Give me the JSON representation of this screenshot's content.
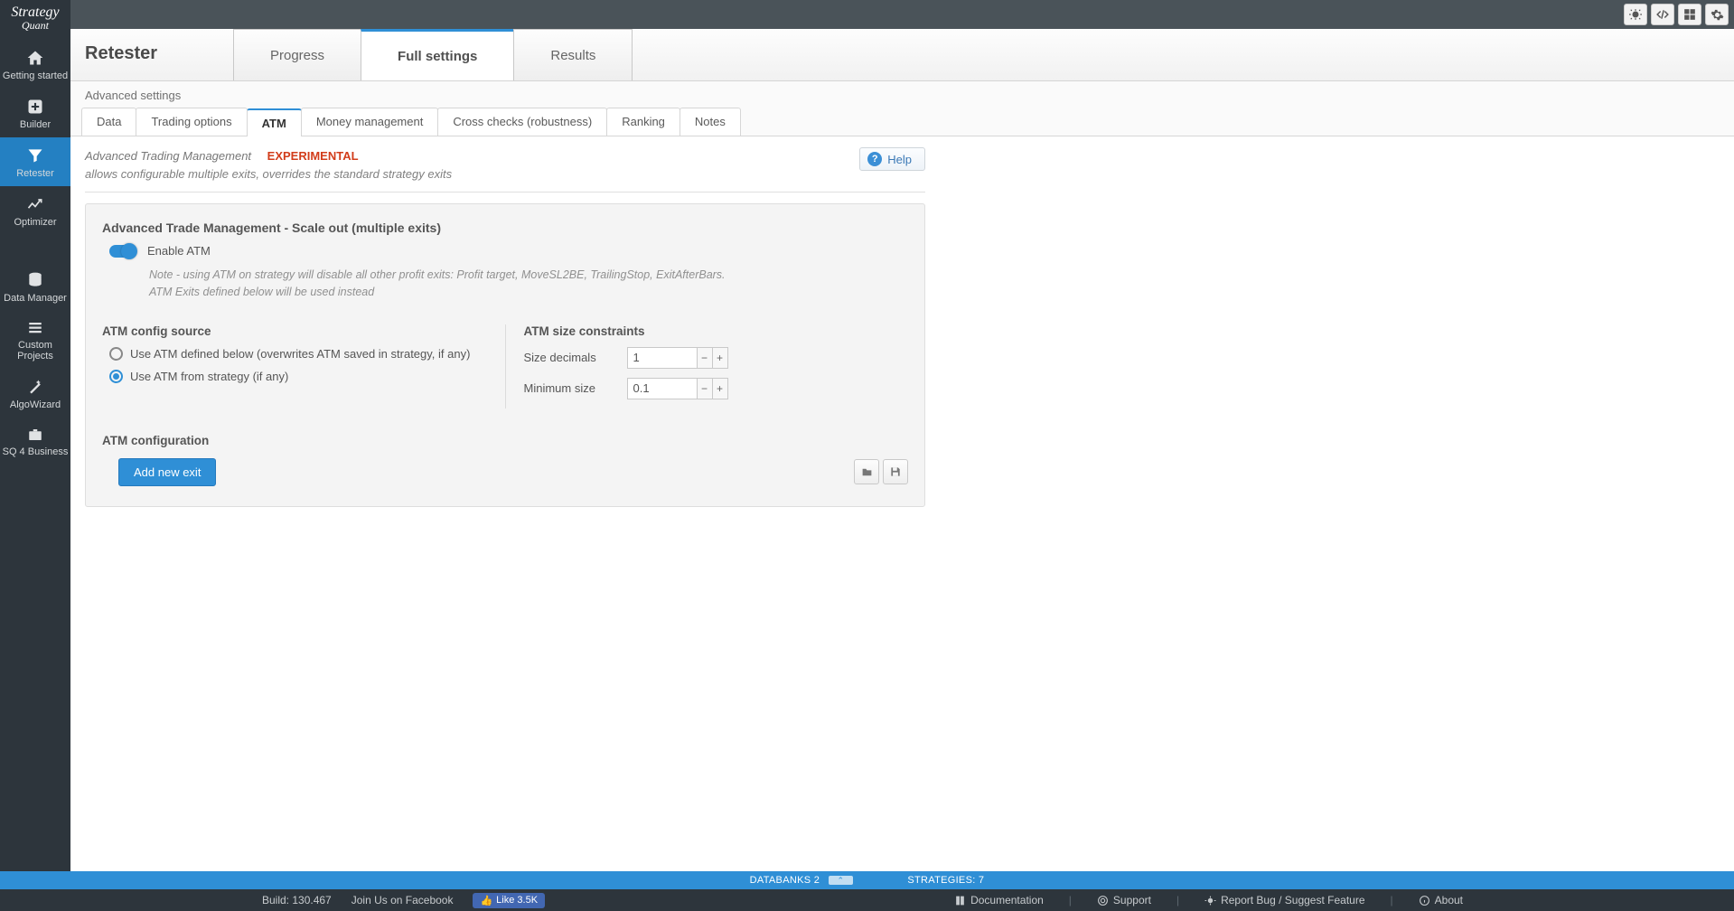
{
  "brand": {
    "line1": "Strategy",
    "line2": "Quant"
  },
  "sidebar": [
    {
      "label": "Getting started",
      "icon": "home-icon"
    },
    {
      "label": "Builder",
      "icon": "plus-icon"
    },
    {
      "label": "Retester",
      "icon": "funnel-icon",
      "active": true
    },
    {
      "label": "Optimizer",
      "icon": "chart-line-icon"
    },
    {
      "label": "Data Manager",
      "icon": "database-icon"
    },
    {
      "label": "Custom Projects",
      "icon": "stack-icon"
    },
    {
      "label": "AlgoWizard",
      "icon": "wand-icon"
    },
    {
      "label": "SQ 4 Business",
      "icon": "briefcase-icon"
    }
  ],
  "page_title": "Retester",
  "main_tabs": [
    {
      "label": "Progress"
    },
    {
      "label": "Full settings",
      "active": true
    },
    {
      "label": "Results"
    }
  ],
  "breadcrumb": "Advanced settings",
  "sub_tabs": [
    {
      "label": "Data"
    },
    {
      "label": "Trading options"
    },
    {
      "label": "ATM",
      "active": true
    },
    {
      "label": "Money management"
    },
    {
      "label": "Cross checks (robustness)"
    },
    {
      "label": "Ranking"
    },
    {
      "label": "Notes"
    }
  ],
  "intro": {
    "title": "Advanced Trading Management",
    "badge": "EXPERIMENTAL",
    "subtitle": "allows configurable multiple exits, overrides the standard strategy exits",
    "help_label": "Help"
  },
  "panel": {
    "heading": "Advanced Trade Management - Scale out (multiple exits)",
    "enable_label": "Enable ATM",
    "enable_value": true,
    "note_line1": "Note - using ATM on strategy will disable all other profit exits: Profit target, MoveSL2BE, TrailingStop, ExitAfterBars.",
    "note_line2": "ATM Exits defined below will be used instead",
    "source": {
      "heading": "ATM config source",
      "options": [
        {
          "label": "Use ATM defined below (overwrites ATM saved in strategy, if any)",
          "checked": false
        },
        {
          "label": "Use ATM from strategy (if any)",
          "checked": true
        }
      ]
    },
    "constraints": {
      "heading": "ATM size constraints",
      "size_decimals_label": "Size decimals",
      "size_decimals_value": "1",
      "minimum_size_label": "Minimum size",
      "minimum_size_value": "0.1"
    },
    "config_heading": "ATM configuration",
    "add_exit_label": "Add new exit"
  },
  "databanks": {
    "left": "DATABANKS 2",
    "right": "STRATEGIES: 7"
  },
  "footer": {
    "build": "Build: 130.467",
    "join": "Join Us on Facebook",
    "like": "Like 3.5K",
    "documentation": "Documentation",
    "support": "Support",
    "report": "Report Bug / Suggest Feature",
    "about": "About"
  }
}
